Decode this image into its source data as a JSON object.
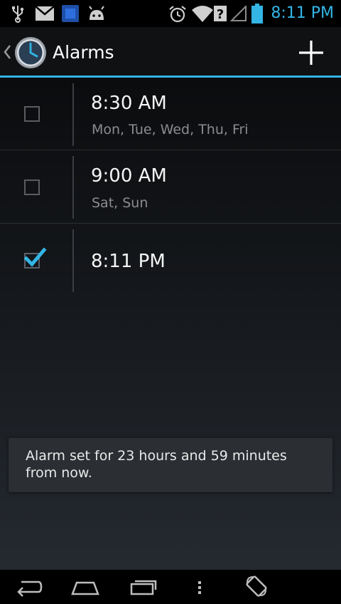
{
  "status_bar": {
    "time": "8:11 PM",
    "accent_color": "#33b5e5",
    "icons": [
      "usb-icon",
      "gmail-icon",
      "app-notification-icon",
      "android-debug-icon",
      "alarm-icon",
      "wifi-icon",
      "no-signal-icon",
      "battery-icon"
    ]
  },
  "action_bar": {
    "title": "Alarms",
    "app_icon": "clock-icon",
    "add_icon": "plus-icon"
  },
  "alarms": [
    {
      "time": "8:30 AM",
      "days": "Mon, Tue, Wed, Thu, Fri",
      "enabled": false
    },
    {
      "time": "9:00 AM",
      "days": "Sat, Sun",
      "enabled": false
    },
    {
      "time": "8:11 PM",
      "days": "",
      "enabled": true
    }
  ],
  "toast": {
    "message": "Alarm set for 23 hours and 59 minutes from now."
  },
  "nav_bar": {
    "buttons": [
      "back-icon",
      "home-icon",
      "recents-icon",
      "menu-icon",
      "rotate-icon"
    ]
  }
}
